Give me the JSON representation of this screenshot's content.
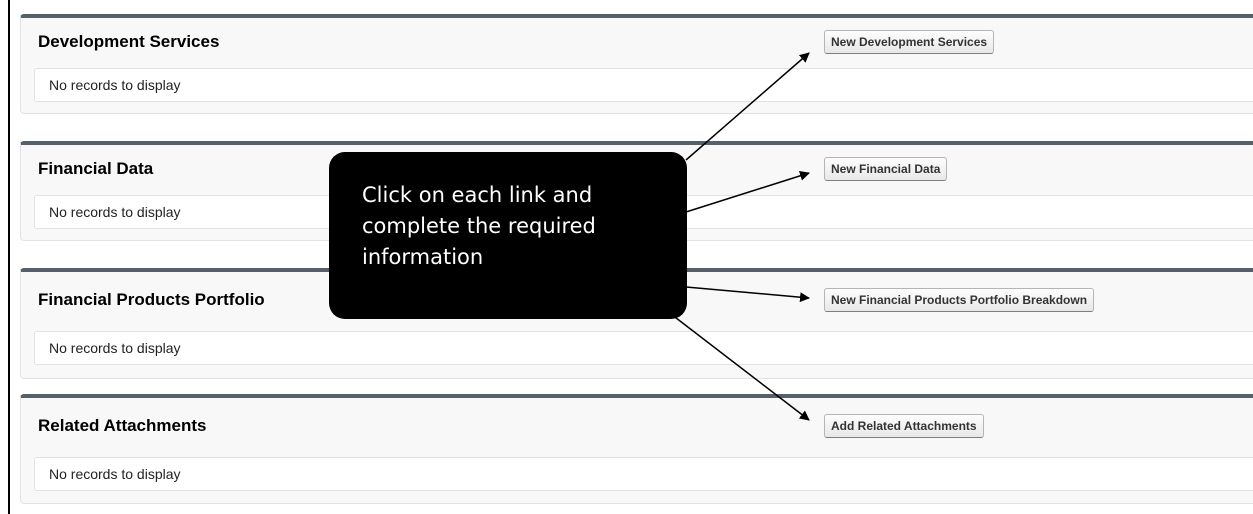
{
  "sections": [
    {
      "title": "Development Services",
      "button_label": "New Development Services",
      "empty_text": "No records to display"
    },
    {
      "title": "Financial Data",
      "button_label": "New Financial Data",
      "empty_text": "No records to display"
    },
    {
      "title": "Financial Products Portfolio",
      "button_label": "New Financial Products Portfolio Breakdown",
      "empty_text": "No records to display"
    },
    {
      "title": "Related Attachments",
      "button_label": "Add Related Attachments",
      "empty_text": "No records to display"
    }
  ],
  "callout": {
    "lines": [
      "Click on each link and",
      "complete the required",
      "information"
    ]
  },
  "colors": {
    "section_border": "#56606a",
    "callout_background": "#000000",
    "callout_text": "#ffffff"
  }
}
